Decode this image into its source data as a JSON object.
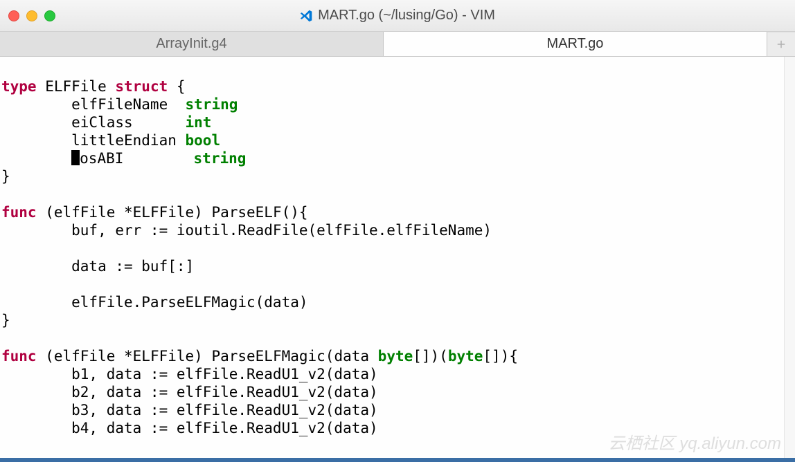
{
  "window": {
    "title": "MART.go (~/lusing/Go) - VIM"
  },
  "tabs": {
    "inactive": "ArrayInit.g4",
    "active": "MART.go"
  },
  "code": {
    "l1_kw1": "type",
    "l1_name": " ELFFile ",
    "l1_kw2": "struct",
    "l1_rest": " {",
    "l2_indent": "        elfFileName  ",
    "l2_type": "string",
    "l3_indent": "        eiClass      ",
    "l3_type": "int",
    "l4_indent": "        littleEndian ",
    "l4_type": "bool",
    "l5_pre": "        ",
    "l5_name": "osABI        ",
    "l5_type": "string",
    "l6": "}",
    "l7": "",
    "l8_kw": "func",
    "l8_rest": " (elfFile *ELFFile) ParseELF(){",
    "l9": "        buf, err := ioutil.ReadFile(elfFile.elfFileName)",
    "l10": "",
    "l11": "        data := buf[:]",
    "l12": "",
    "l13": "        elfFile.ParseELFMagic(data)",
    "l14": "}",
    "l15": "",
    "l16_kw": "func",
    "l16_mid": " (elfFile *ELFFile) ParseELFMagic(data ",
    "l16_type1": "byte",
    "l16_brackets1": "[])(",
    "l16_type2": "byte",
    "l16_brackets2": "[]){",
    "l17": "        b1, data := elfFile.ReadU1_v2(data)",
    "l18": "        b2, data := elfFile.ReadU1_v2(data)",
    "l19": "        b3, data := elfFile.ReadU1_v2(data)",
    "l20": "        b4, data := elfFile.ReadU1_v2(data)"
  },
  "watermark": "云栖社区 yq.aliyun.com"
}
